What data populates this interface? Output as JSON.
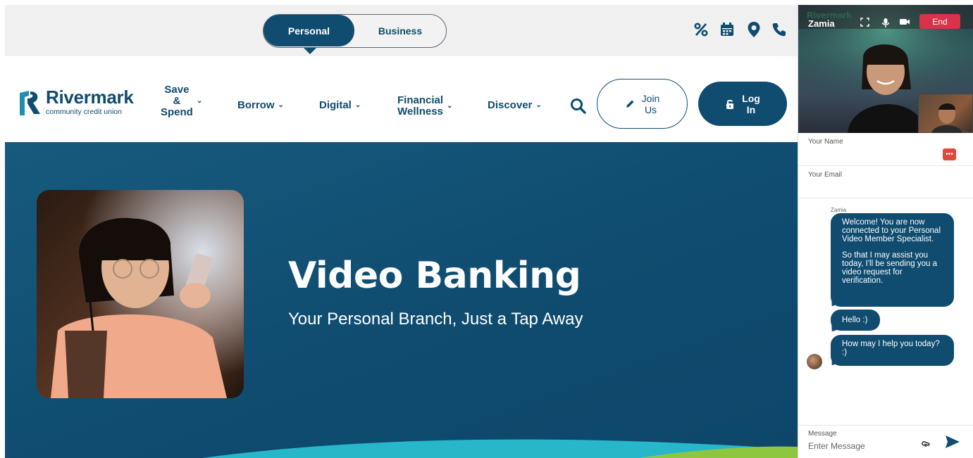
{
  "site": {
    "segments": {
      "personal": "Personal",
      "business": "Business"
    },
    "utility_icons": [
      "percent-icon",
      "calendar-icon",
      "location-icon",
      "phone-icon"
    ],
    "logo": {
      "name": "Rivermark",
      "subtitle": "community credit union"
    },
    "nav": {
      "save_spend": [
        "Save",
        "&",
        "Spend"
      ],
      "borrow": "Borrow",
      "digital": "Digital",
      "financial_wellness": [
        "Financial",
        "Wellness"
      ],
      "discover": "Discover"
    },
    "join": [
      "Join",
      "Us"
    ],
    "login": [
      "Log",
      "In"
    ],
    "hero": {
      "title": "Video Banking",
      "subtitle": "Your Personal Branch, Just a Tap Away"
    },
    "colors": {
      "brand": "#0f4c6f",
      "accent_wave": "#27b7c9",
      "accent_green": "#8dc63f"
    }
  },
  "chat": {
    "caller_name": "Zamia",
    "watermark": "Rivermark",
    "end_label": "End",
    "fields": {
      "name_label": "Your Name",
      "email_label": "Your Email"
    },
    "sender": "Zamia",
    "messages": {
      "welcome": [
        "Welcome! You are now connected to your Personal Video Member Specialist.",
        "So that I may assist you today, I'll be sending you a video request for verification."
      ],
      "hello": "Hello :)",
      "help": "How may I help you today? :)"
    },
    "composer": {
      "label": "Message",
      "placeholder": "Enter Message"
    },
    "colors": {
      "end_button": "#d9324a",
      "bubble": "#0f4c6f"
    }
  }
}
